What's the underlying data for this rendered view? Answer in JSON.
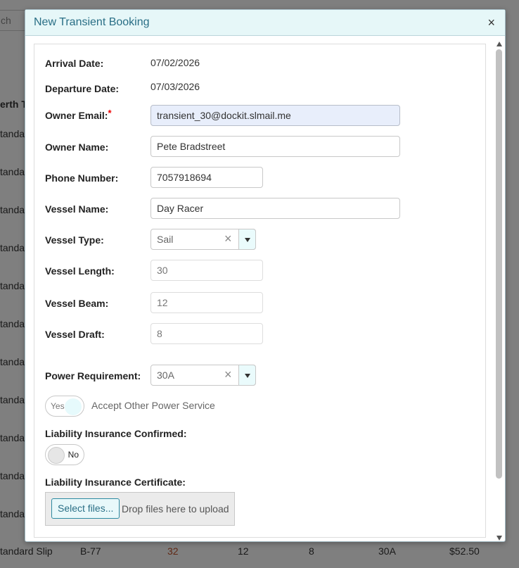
{
  "background": {
    "search_placeholder": "ch",
    "column_header": "erth T",
    "row_label": "tandar",
    "last_row": {
      "type": "tandard Slip",
      "slip": "B-77",
      "length": "32",
      "beam": "12",
      "draft": "8",
      "power": "30A",
      "price": "$52.50"
    }
  },
  "modal": {
    "title": "New Transient Booking",
    "close_symbol": "×"
  },
  "form": {
    "arrival_label": "Arrival Date:",
    "arrival_value": "07/02/2026",
    "departure_label": "Departure Date:",
    "departure_value": "07/03/2026",
    "owner_email_label": "Owner Email:",
    "required_mark": "*",
    "owner_email_value": "transient_30@dockit.slmail.me",
    "owner_name_label": "Owner Name:",
    "owner_name_value": "Pete Bradstreet",
    "phone_label": "Phone Number:",
    "phone_value": "7057918694",
    "vessel_name_label": "Vessel Name:",
    "vessel_name_value": "Day Racer",
    "vessel_type_label": "Vessel Type:",
    "vessel_type_value": "Sail",
    "vessel_length_label": "Vessel Length:",
    "vessel_length_value": "30",
    "vessel_beam_label": "Vessel Beam:",
    "vessel_beam_value": "12",
    "vessel_draft_label": "Vessel Draft:",
    "vessel_draft_value": "8",
    "power_label": "Power Requirement:",
    "power_value": "30A",
    "clear_symbol": "×",
    "accept_power_switch_text": "Yes",
    "accept_power_label": "Accept Other Power Service",
    "insurance_label": "Liability Insurance Confirmed:",
    "insurance_switch_text": "No",
    "certificate_label": "Liability Insurance Certificate:",
    "select_files_label": "Select files...",
    "drop_text": "Drop files here to upload"
  },
  "colors": {
    "header_bg": "#e6f7f8",
    "title_color": "#2a6f86",
    "focused_input_bg": "#e8eefb",
    "required_color": "#ee0000",
    "highlight_number": "#c0522a"
  },
  "icons": {
    "close": "close-icon",
    "dropdown": "chevron-down-icon",
    "scroll_up": "scroll-up-arrow-icon",
    "scroll_down": "scroll-down-arrow-icon"
  }
}
